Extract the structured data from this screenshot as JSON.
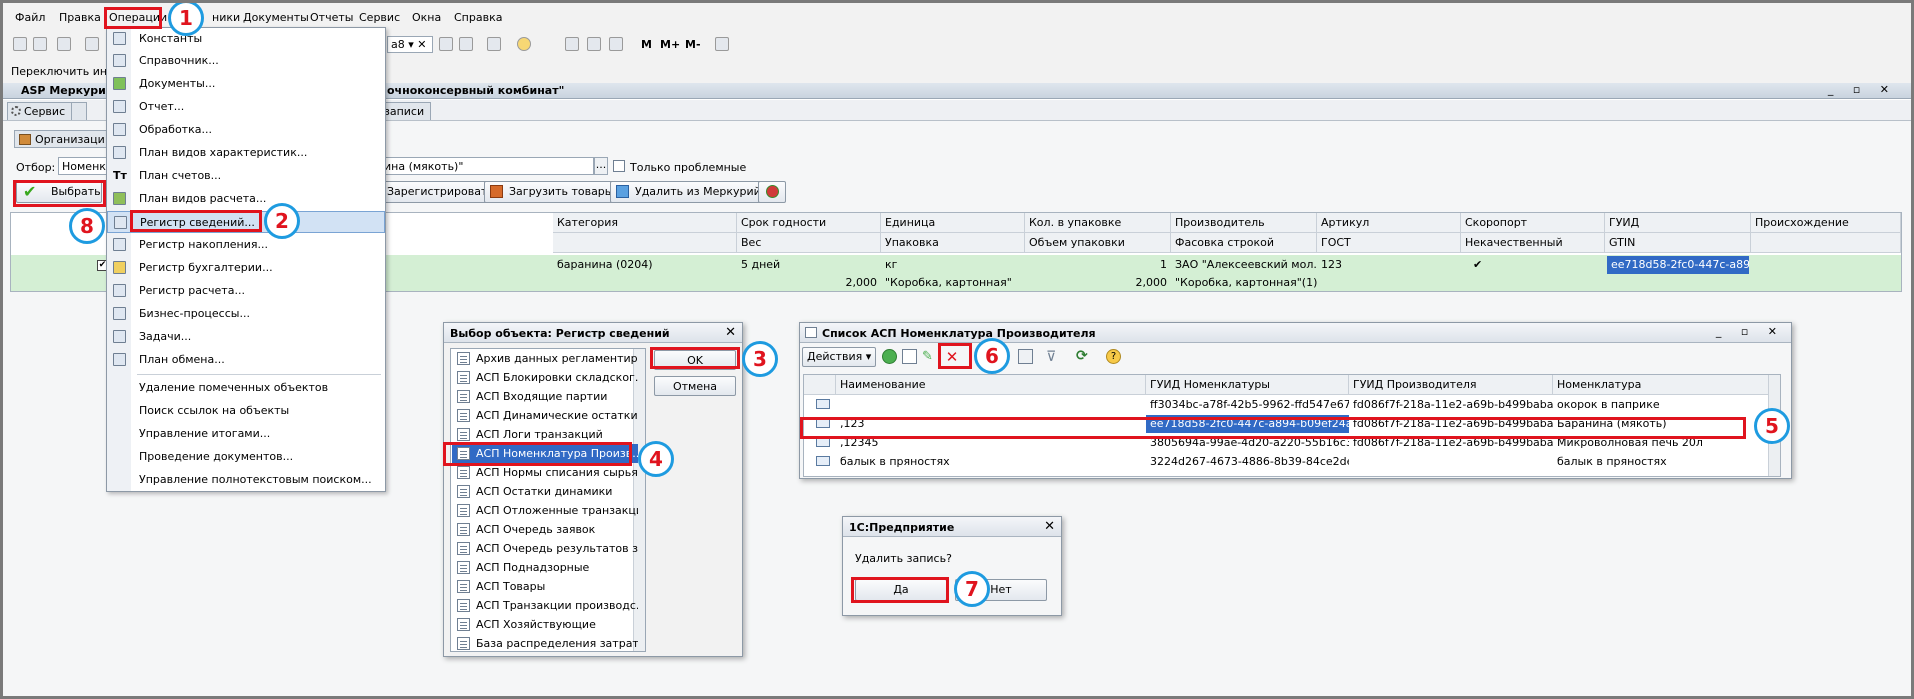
{
  "menubar": {
    "items": [
      "Файл",
      "Правка",
      "Операции",
      "Справочники",
      "Документы",
      "Отчеты",
      "Сервис",
      "Окна",
      "Справка"
    ],
    "sprav_visible": "ники"
  },
  "toolbar": {
    "m_labels": [
      "M",
      "M+",
      "M-"
    ],
    "a8": "a8"
  },
  "subline": {
    "text": "Переключить инте"
  },
  "window": {
    "title_left": "ASP Меркурий",
    "title_right": "очноконсервный комбинат\""
  },
  "tabs": {
    "service": "Сервис",
    "records": "записи",
    "org": "Организаци"
  },
  "filter": {
    "label": "Отбор:",
    "field1": "Номенкл",
    "field2": "ина (мякоть)\"",
    "dots": "...",
    "only_problem": "Только проблемные"
  },
  "buttons": {
    "select": "Выбрать",
    "register": "Зарегистрировать",
    "load": "Загрузить товары",
    "delete_merc": "Удалить из Меркурий"
  },
  "grid": {
    "headers_top": [
      "Категория",
      "Срок годности",
      "Единица",
      "Кол. в упаковке",
      "Производитель",
      "Артикул",
      "Скоропорт",
      "ГУИД",
      "Происхождение"
    ],
    "headers_bottom": [
      "",
      "Вес",
      "Упаковка",
      "Объем упаковки",
      "Фасовка строкой",
      "ГОСТ",
      "Некачественный",
      "GTIN",
      ""
    ],
    "row1": [
      "баранина (0204)",
      "5 дней",
      "кг",
      "1",
      "ЗАО \"Алексеевский мол...",
      "123",
      "✔",
      "ee718d58-2fc0-447c-a894..."
    ],
    "row2": [
      "2,000",
      "\"Коробка, картонная\"",
      "2,000",
      "\"Коробка, картонная\"(1)"
    ]
  },
  "menu": {
    "items": [
      "Константы",
      "Справочник...",
      "Документы...",
      "Отчет...",
      "Обработка...",
      "План видов характеристик...",
      "План счетов...",
      "План видов расчета...",
      "Регистр сведений...",
      "Регистр накопления...",
      "Регистр бухгалтерии...",
      "Регистр расчета...",
      "Бизнес-процессы...",
      "Задачи...",
      "План обмена..."
    ],
    "items2": [
      "Удаление помеченных объектов",
      "Поиск ссылок на объекты",
      "Управление итогами...",
      "Проведение документов...",
      "Управление полнотекстовым поиском..."
    ]
  },
  "select_dialog": {
    "title": "Выбор объекта: Регистр сведений",
    "items": [
      "Архив данных регламентиро...",
      "АСП Блокировки складског...",
      "АСП Входящие партии",
      "АСП Динамические остатки",
      "АСП Логи транзакций",
      "АСП Номенклатура Произв...",
      "АСП Нормы списания сырья",
      "АСП Остатки динамики",
      "АСП Отложенные транзакции",
      "АСП Очередь заявок",
      "АСП Очередь результатов з...",
      "АСП Поднадзорные",
      "АСП Товары",
      "АСП Транзакции производс...",
      "АСП Хозяйствующие",
      "База распределения затрат..."
    ],
    "ok": "OK",
    "cancel": "Отмена"
  },
  "list_window": {
    "title": "Список АСП Номенклатура Производителя",
    "actions": "Действия",
    "headers": [
      "Наименование",
      "ГУИД Номенклатуры",
      "ГУИД Производителя",
      "Номенклатура"
    ],
    "rows": [
      [
        "",
        "ff3034bc-a78f-42b5-9962-ffd547e67f6e",
        "fd086f7f-218a-11e2-a69b-b499babae7ea",
        "окорок в паприке"
      ],
      [
        ",123",
        "ee718d58-2fc0-447c-a894-b09ef24ab...",
        "fd086f7f-218a-11e2-a69b-b499babae7ea",
        "Баранина (мякоть)"
      ],
      [
        ",12345",
        "3805694a-99ae-4d20-a220-55b16c3a...",
        "fd086f7f-218a-11e2-a69b-b499babae7ea",
        "Микроволновая печь 20л"
      ],
      [
        "балык в пряностях",
        "3224d267-4673-4886-8b39-84ce2de5...",
        "",
        "балык в пряностях"
      ]
    ]
  },
  "confirm": {
    "title": "1С:Предприятие",
    "question": "Удалить запись?",
    "yes": "Да",
    "no": "Нет"
  },
  "badges": [
    "1",
    "2",
    "3",
    "4",
    "5",
    "6",
    "7",
    "8"
  ],
  "colors": {
    "highlight": "#e0141e",
    "badge_ring": "#1e9be0",
    "row_green": "#d4efd4",
    "selection": "#316ac5"
  }
}
